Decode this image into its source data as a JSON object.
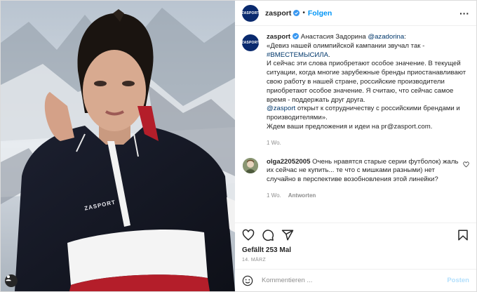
{
  "post": {
    "author": "zasport",
    "avatar_text": "ZASPORT",
    "follow_label": "Folgen",
    "more_icon": "more-horizontal-icon",
    "photo_brand_text": "ZASPORT"
  },
  "caption": {
    "author": "zasport",
    "line_start": "Анастасия Задорина ",
    "mention": "@azadorina",
    "line_end": ":",
    "p1": "«Девиз нашей олимпийской кампании звучал так -",
    "hashtag": "#ВМЕСТЕМЫСИЛА",
    "p1_end": ".",
    "p2": "И сейчас эти слова приобретают особое значение. В текущей ситуации, когда многие зарубежные бренды приостанавливают свою работу в нашей стране, российские производители приобретают особое значение. Я считаю, что сейчас самое время - поддержать друг друга.",
    "mention2": "@zasport",
    "p3": " открыт к сотрудничеству с российскими брендами и производителями».",
    "p4": "Ждем ваши предложения и идеи на pr@zasport.com.",
    "time": "1 Wo."
  },
  "comment": {
    "author": "olga22052005",
    "text": " Очень нравятся старые серии футболок) жаль их сейчас не купить... те что с мишками разными) нет случайно в перспективе возобновления этой линейки?",
    "time": "1 Wo.",
    "reply_label": "Antworten"
  },
  "footer": {
    "likes": "Gefällt 253 Mal",
    "date": "14. MÄRZ",
    "comment_placeholder": "Kommentieren ...",
    "post_label": "Posten"
  },
  "colors": {
    "brand_navy": "#0a2a6e",
    "link_blue": "#0095f6",
    "verified_blue": "#3897f0"
  }
}
